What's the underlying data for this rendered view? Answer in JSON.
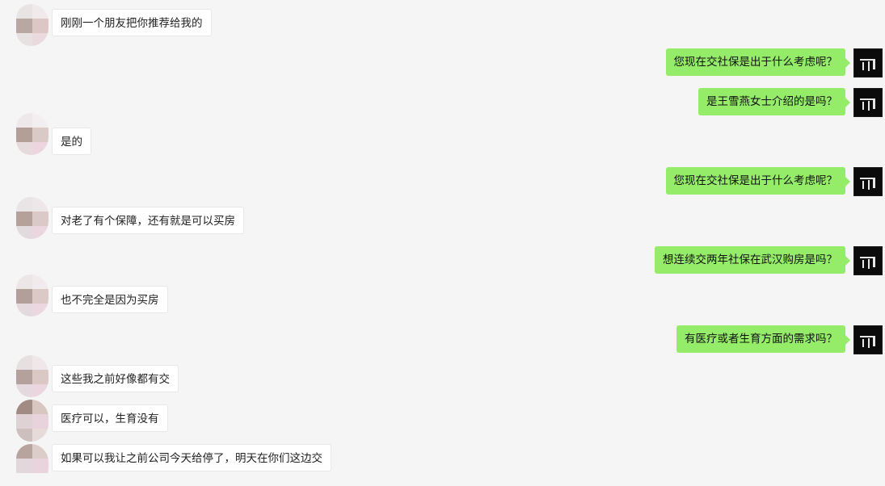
{
  "messages": [
    {
      "side": "left",
      "text": "刚刚一个朋友把你推荐给我的"
    },
    {
      "side": "right",
      "text": "您现在交社保是出于什么考虑呢？"
    },
    {
      "side": "right",
      "text": "是王雪燕女士介绍的是吗？"
    },
    {
      "side": "left",
      "text": "是的"
    },
    {
      "side": "right",
      "text": "您现在交社保是出于什么考虑呢？"
    },
    {
      "side": "left",
      "text": "对老了有个保障，还有就是可以买房"
    },
    {
      "side": "right",
      "text": "想连续交两年社保在武汉购房是吗？"
    },
    {
      "side": "left",
      "text": "也不完全是因为买房"
    },
    {
      "side": "right",
      "text": "有医疗或者生育方面的需求吗？"
    },
    {
      "side": "left",
      "text": "这些我之前好像都有交"
    },
    {
      "side": "left",
      "text": "医疗可以，生育没有"
    },
    {
      "side": "left",
      "text": "如果可以我让之前公司今天给停了，明天在你们这边交"
    }
  ]
}
